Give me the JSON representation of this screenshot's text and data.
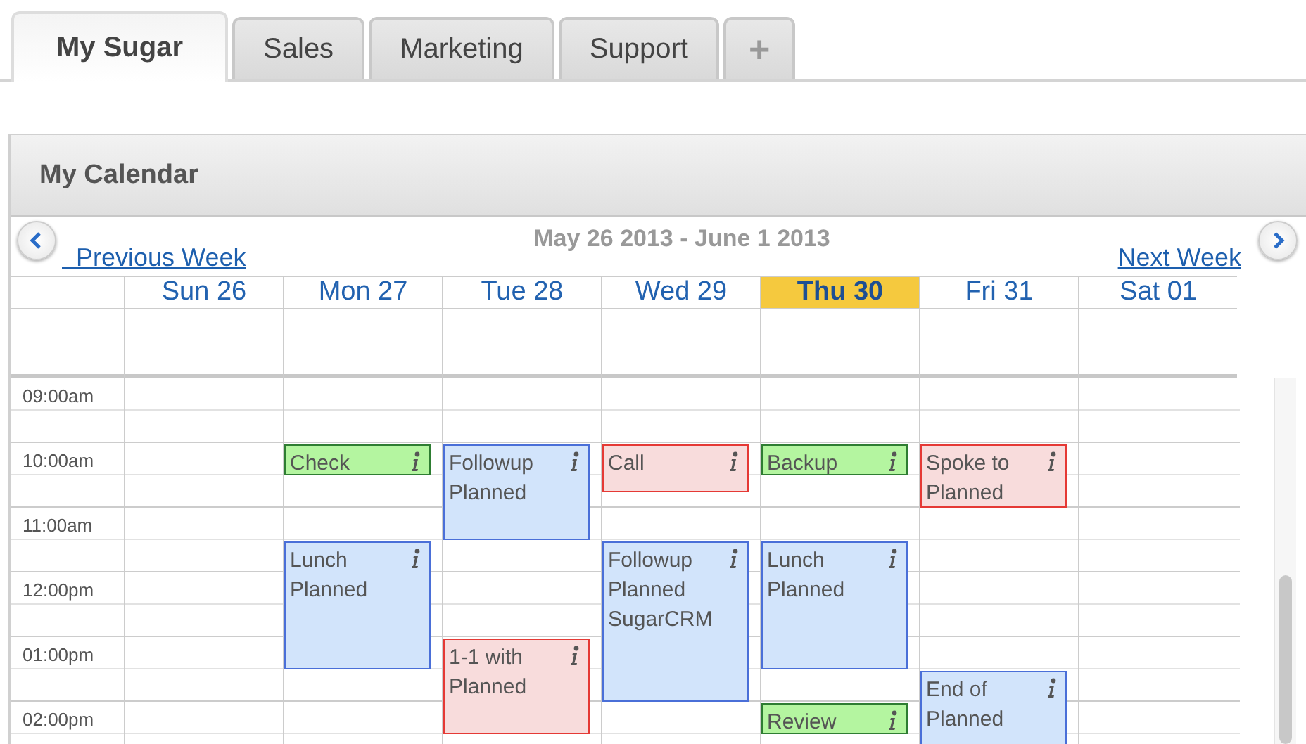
{
  "tabs": [
    {
      "label": "My Sugar",
      "selected": true
    },
    {
      "label": "Sales",
      "selected": false
    },
    {
      "label": "Marketing",
      "selected": false
    },
    {
      "label": "Support",
      "selected": false
    },
    {
      "label": "+",
      "selected": false
    }
  ],
  "calendar": {
    "title": "My Calendar",
    "range": "May 26 2013 - June 1 2013",
    "previous": "Previous Week",
    "next": "Next Week",
    "times": [
      "09:00am",
      "10:00am",
      "11:00am",
      "12:00pm",
      "01:00pm",
      "02:00pm"
    ],
    "days": [
      {
        "label": "Sun 26",
        "selected": false
      },
      {
        "label": "Mon 27",
        "selected": false,
        "events": [
          {
            "lines": [
              "Check"
            ],
            "color": "#b4f5a0"
          },
          {
            "lines": [
              "Lunch",
              "Planned"
            ],
            "color": "#d2e4fb"
          }
        ]
      },
      {
        "label": "Tue 28",
        "selected": false,
        "events": [
          {
            "lines": [
              "Followup",
              "Planned"
            ],
            "color": "#d2e4fb"
          },
          {
            "lines": [
              "1-1 with",
              "Planned"
            ],
            "color": "#f8dcdc"
          }
        ]
      },
      {
        "label": "Wed 29",
        "selected": false,
        "events": [
          {
            "lines": [
              "Call"
            ],
            "color": "#f8dcdc"
          },
          {
            "lines": [
              "Followup",
              "Planned",
              "SugarCRM"
            ],
            "color": "#d2e4fb"
          }
        ]
      },
      {
        "label": "Thu 30",
        "selected": true,
        "events": [
          {
            "lines": [
              "Backup"
            ],
            "color": "#b4f5a0"
          },
          {
            "lines": [
              "Lunch",
              "Planned"
            ],
            "color": "#d2e4fb"
          },
          {
            "lines": [
              "Review"
            ],
            "color": "#b4f5a0"
          }
        ]
      },
      {
        "label": "Fri 31",
        "selected": false,
        "events": [
          {
            "lines": [
              "Spoke to",
              "Planned"
            ],
            "color": "#f8dcdc"
          },
          {
            "lines": [
              "End of",
              "Planned"
            ],
            "color": "#d2e4fb"
          }
        ]
      },
      {
        "label": "Sat 01",
        "selected": false
      }
    ]
  }
}
